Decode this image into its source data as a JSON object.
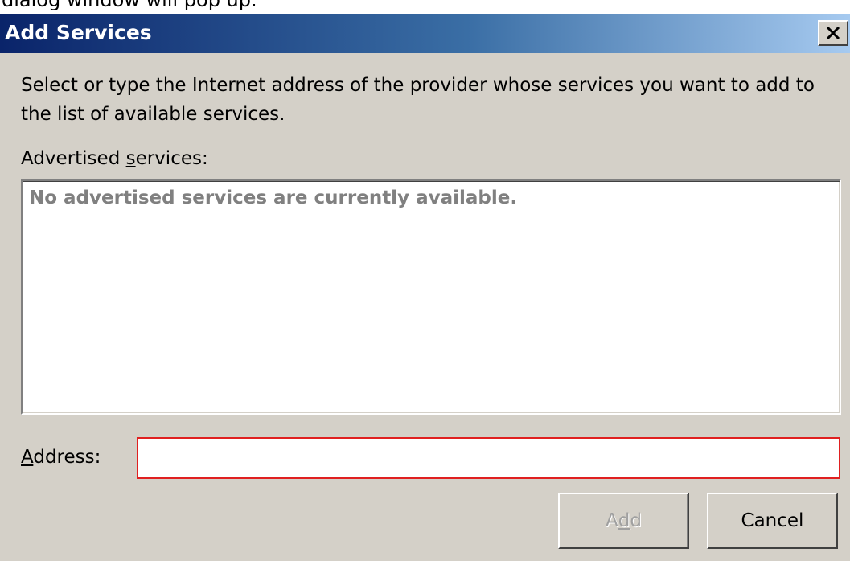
{
  "page_caption": "dialog window will pop up.",
  "dialog": {
    "title": "Add Services",
    "close_icon": "close-icon",
    "description": "Select or type the Internet address of the provider whose services you want to add to the list of available services.",
    "advertised_label_before": "Advertised ",
    "advertised_label_mnemonic": "s",
    "advertised_label_after": "ervices:",
    "empty_message": "No advertised services are currently available.",
    "address_label_mnemonic": "A",
    "address_label_after": "ddress:",
    "address_value": "",
    "add_label_before": "A",
    "add_label_mnemonic": "d",
    "add_label_after": "d",
    "cancel_label": "Cancel"
  },
  "colors": {
    "title_gradient_start": "#0a246a",
    "title_gradient_end": "#a6caf0",
    "dialog_bg": "#d4d0c8",
    "address_border": "#e02020",
    "disabled_text": "#a0a0a0"
  }
}
